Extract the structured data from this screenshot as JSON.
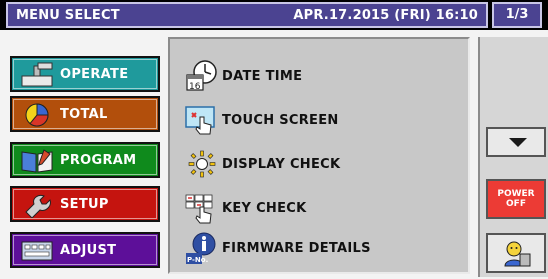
{
  "header": {
    "title": "MENU SELECT",
    "datetime": "APR.17.2015 (FRI) 16:10",
    "page": "1/3"
  },
  "categories": [
    {
      "label": "OPERATE",
      "icon": "operate-icon",
      "color": "#1f9a9c"
    },
    {
      "label": "TOTAL",
      "icon": "pie-chart-icon",
      "color": "#b24f0c"
    },
    {
      "label": "PROGRAM",
      "icon": "book-icon",
      "color": "#0f8a1c"
    },
    {
      "label": "SETUP",
      "icon": "wrench-icon",
      "color": "#c5140f"
    },
    {
      "label": "ADJUST",
      "icon": "keyboard-icon",
      "color": "#5d0f99"
    }
  ],
  "items": [
    {
      "label": "DATE TIME",
      "icon": "clock-calendar-icon"
    },
    {
      "label": "TOUCH SCREEN",
      "icon": "touch-icon"
    },
    {
      "label": "DISPLAY CHECK",
      "icon": "sun-icon"
    },
    {
      "label": "KEY CHECK",
      "icon": "key-press-icon"
    },
    {
      "label": "FIRMWARE DETAILS",
      "icon": "info-icon"
    }
  ],
  "right": {
    "power_line1": "POWER",
    "power_line2": "OFF",
    "down_icon": "chevron-down-icon",
    "logout_icon": "operator-icon"
  }
}
